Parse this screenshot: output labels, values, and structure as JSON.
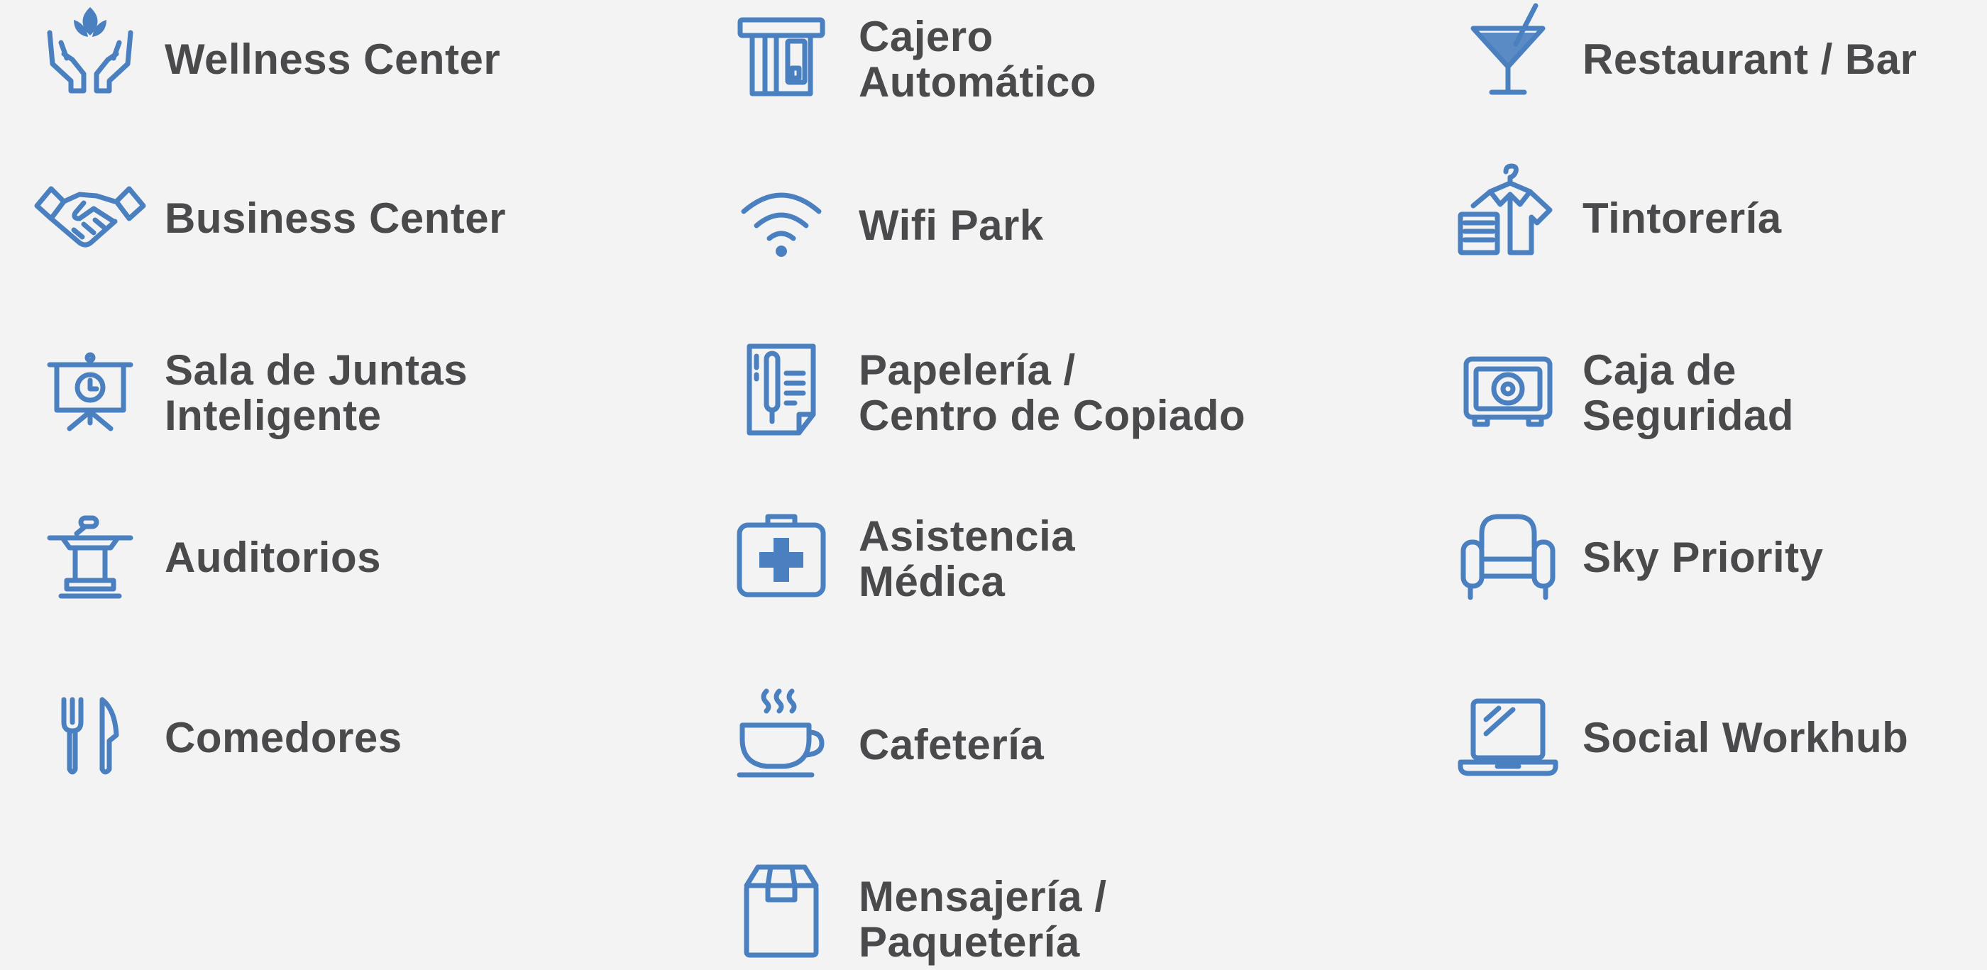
{
  "accent_color": "#4a80c0",
  "text_color": "#4a4a4c",
  "background_color": "#f3f3f4",
  "amenities": {
    "wellness": {
      "icon": "wellness-lotus-hands-icon",
      "line1": "Wellness Center",
      "line2": ""
    },
    "cajero": {
      "icon": "atm-card-icon",
      "line1": "Cajero",
      "line2": "Automático"
    },
    "restaurant": {
      "icon": "cocktail-glass-icon",
      "line1": "Restaurant / Bar",
      "line2": ""
    },
    "business": {
      "icon": "handshake-icon",
      "line1": "Business Center",
      "line2": ""
    },
    "wifi": {
      "icon": "wifi-icon",
      "line1": "Wifi Park",
      "line2": ""
    },
    "tintoreria": {
      "icon": "shirt-hanger-icon",
      "line1": "Tintorería",
      "line2": ""
    },
    "sala": {
      "icon": "presentation-board-icon",
      "line1": "Sala de Juntas",
      "line2": "Inteligente"
    },
    "papeleria": {
      "icon": "document-pen-icon",
      "line1": "Papelería /",
      "line2": "Centro de Copiado"
    },
    "caja": {
      "icon": "safe-box-icon",
      "line1": "Caja de",
      "line2": "Seguridad"
    },
    "auditorios": {
      "icon": "podium-icon",
      "line1": "Auditorios",
      "line2": ""
    },
    "asistencia": {
      "icon": "first-aid-kit-icon",
      "line1": "Asistencia",
      "line2": "Médica"
    },
    "sky": {
      "icon": "armchair-icon",
      "line1": "Sky Priority",
      "line2": ""
    },
    "comedores": {
      "icon": "fork-knife-icon",
      "line1": "Comedores",
      "line2": ""
    },
    "cafeteria": {
      "icon": "coffee-cup-icon",
      "line1": "Cafetería",
      "line2": ""
    },
    "social": {
      "icon": "laptop-icon",
      "line1": "Social Workhub",
      "line2": ""
    },
    "mensajeria": {
      "icon": "package-box-icon",
      "line1": "Mensajería /",
      "line2": "Paquetería"
    }
  }
}
